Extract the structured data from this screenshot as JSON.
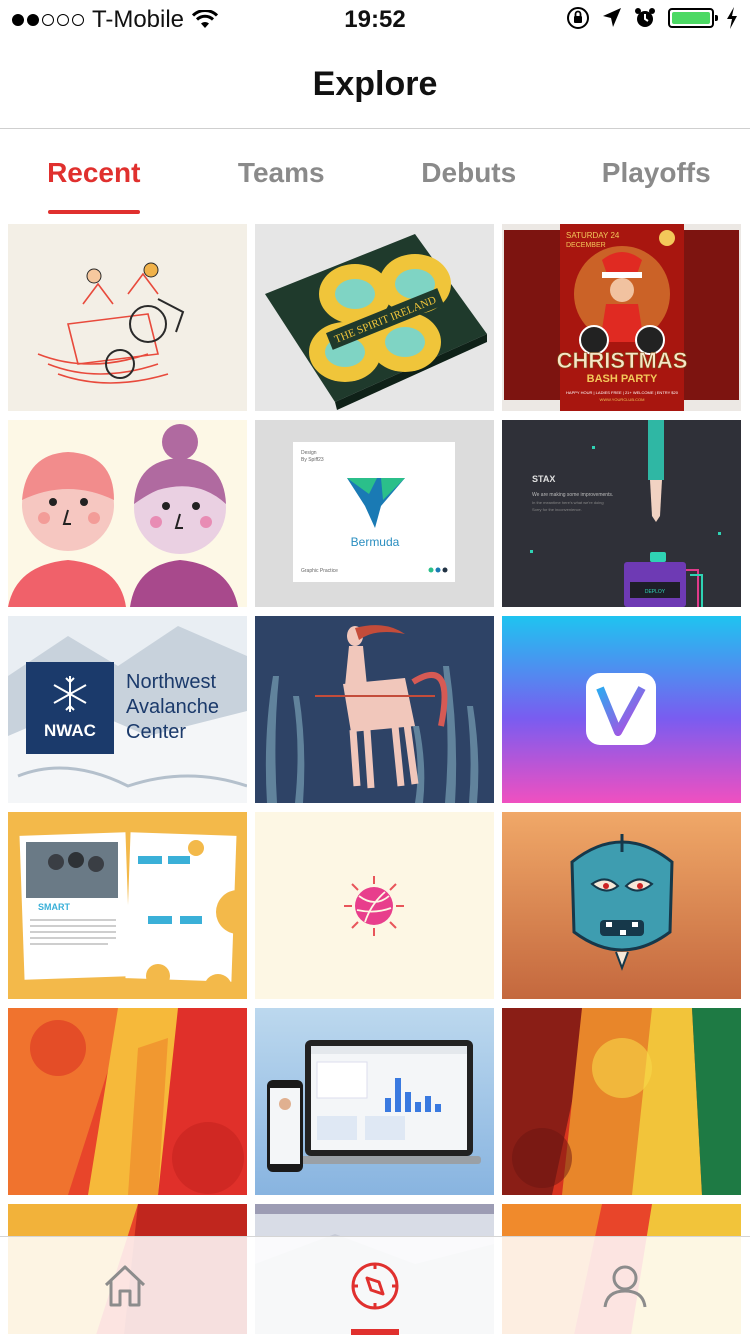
{
  "status_bar": {
    "carrier": "T-Mobile",
    "time": "19:52",
    "signal_bars_filled": 2,
    "signal_bars_total": 5,
    "battery_level": 1.0
  },
  "nav": {
    "title": "Explore"
  },
  "tabs": [
    {
      "label": "Recent",
      "active": true
    },
    {
      "label": "Teams",
      "active": false
    },
    {
      "label": "Debuts",
      "active": false
    },
    {
      "label": "Playoffs",
      "active": false
    }
  ],
  "shots": {
    "spirit": {
      "line1": "THE",
      "line2": "SPIRIT",
      "line3": "IRELAND"
    },
    "christmas": {
      "date_a": "SATURDAY 24",
      "date_b": "DECEMBER",
      "title": "CHRISTMAS",
      "subtitle": "BASH PARTY",
      "footer": "HAPPY HOUR | LADIES FREE | 21+ WELCOME | ENTRY $20",
      "site": "WWW.YOURCLUB.COM"
    },
    "bermuda": {
      "top": "Design",
      "by": "By Spiff23",
      "name": "Bermuda",
      "foot": "Graphic Practice"
    },
    "stax": {
      "brand": "STAX",
      "line1": "We are making some improvements.",
      "line2": "In the meantime here's what we're doing",
      "line3": "Sorry for the inconvenience.",
      "button": "DEPLOY"
    },
    "nwac": {
      "badge": "NWAC",
      "line1": "Northwest",
      "line2": "Avalanche",
      "line3": "Center"
    },
    "smart": {
      "word": "SMART"
    }
  },
  "bottom_nav": [
    {
      "icon": "home-icon",
      "active": false
    },
    {
      "icon": "compass-icon",
      "active": true
    },
    {
      "icon": "profile-icon",
      "active": false
    }
  ],
  "colors": {
    "accent": "#e0302e",
    "inactive_tab": "#8a8a8a",
    "icon_gray": "#8c8c8c",
    "battery": "#4cd964"
  }
}
